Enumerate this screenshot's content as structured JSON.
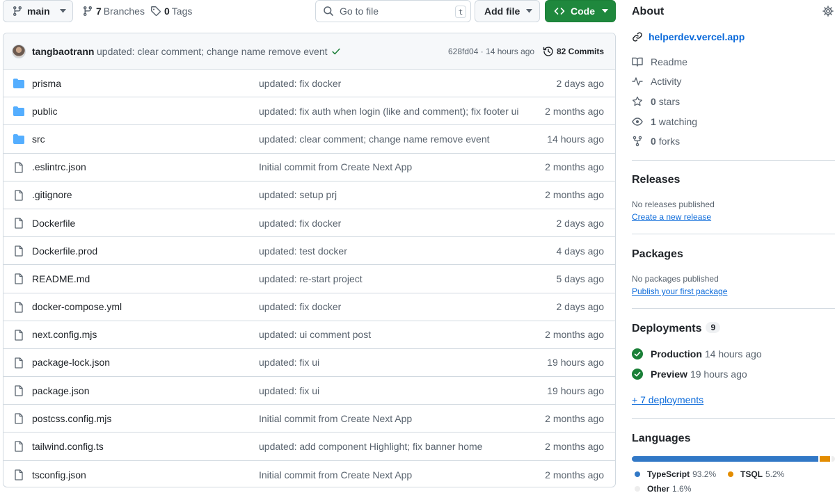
{
  "toolbar": {
    "branch": "main",
    "branches_count": "7",
    "branches_label": "Branches",
    "tags_count": "0",
    "tags_label": "Tags",
    "goto_placeholder": "Go to file",
    "goto_shortcut": "t",
    "add_file": "Add file",
    "code": "Code"
  },
  "commit": {
    "author": "tangbaotrann",
    "message": "updated: clear comment; change name remove event",
    "sha_time": "628fd04 · 14 hours ago",
    "commits": "82 Commits"
  },
  "files": [
    {
      "type": "dir",
      "name": "prisma",
      "message": "updated: fix docker",
      "date": "2 days ago"
    },
    {
      "type": "dir",
      "name": "public",
      "message": "updated: fix auth when login (like and comment); fix footer ui",
      "date": "2 months ago"
    },
    {
      "type": "dir",
      "name": "src",
      "message": "updated: clear comment; change name remove event",
      "date": "14 hours ago"
    },
    {
      "type": "file",
      "name": ".eslintrc.json",
      "message": "Initial commit from Create Next App",
      "date": "2 months ago"
    },
    {
      "type": "file",
      "name": ".gitignore",
      "message": "updated: setup prj",
      "date": "2 months ago"
    },
    {
      "type": "file",
      "name": "Dockerfile",
      "message": "updated: fix docker",
      "date": "2 days ago"
    },
    {
      "type": "file",
      "name": "Dockerfile.prod",
      "message": "updated: test docker",
      "date": "4 days ago"
    },
    {
      "type": "file",
      "name": "README.md",
      "message": "updated: re-start project",
      "date": "5 days ago"
    },
    {
      "type": "file",
      "name": "docker-compose.yml",
      "message": "updated: fix docker",
      "date": "2 days ago"
    },
    {
      "type": "file",
      "name": "next.config.mjs",
      "message": "updated: ui comment post",
      "date": "2 months ago"
    },
    {
      "type": "file",
      "name": "package-lock.json",
      "message": "updated: fix ui",
      "date": "19 hours ago"
    },
    {
      "type": "file",
      "name": "package.json",
      "message": "updated: fix ui",
      "date": "19 hours ago"
    },
    {
      "type": "file",
      "name": "postcss.config.mjs",
      "message": "Initial commit from Create Next App",
      "date": "2 months ago"
    },
    {
      "type": "file",
      "name": "tailwind.config.ts",
      "message": "updated: add component Highlight; fix banner home",
      "date": "2 months ago"
    },
    {
      "type": "file",
      "name": "tsconfig.json",
      "message": "Initial commit from Create Next App",
      "date": "2 months ago"
    }
  ],
  "about": {
    "heading": "About",
    "website": "helperdev.vercel.app",
    "readme": "Readme",
    "activity": "Activity",
    "stars_count": "0",
    "stars_label": "stars",
    "watching_count": "1",
    "watching_label": "watching",
    "forks_count": "0",
    "forks_label": "forks"
  },
  "releases": {
    "heading": "Releases",
    "empty": "No releases published",
    "create": "Create a new release"
  },
  "packages": {
    "heading": "Packages",
    "empty": "No packages published",
    "publish": "Publish your first package"
  },
  "deployments": {
    "heading": "Deployments",
    "count": "9",
    "items": [
      {
        "env": "Production",
        "ago": "14 hours ago"
      },
      {
        "env": "Preview",
        "ago": "19 hours ago"
      }
    ],
    "more": "+ 7 deployments"
  },
  "languages": {
    "heading": "Languages",
    "items": [
      {
        "name": "TypeScript",
        "percent": "93.2%",
        "share": 93.2,
        "color": "#3178c6"
      },
      {
        "name": "TSQL",
        "percent": "5.2%",
        "share": 5.2,
        "color": "#e38c00"
      },
      {
        "name": "Other",
        "percent": "1.6%",
        "share": 1.6,
        "color": "#ededed"
      }
    ]
  },
  "colors": {
    "accent": "#0969da",
    "primary_button": "#1f883d",
    "folder": "#54aeff",
    "success": "#1a7f37"
  }
}
